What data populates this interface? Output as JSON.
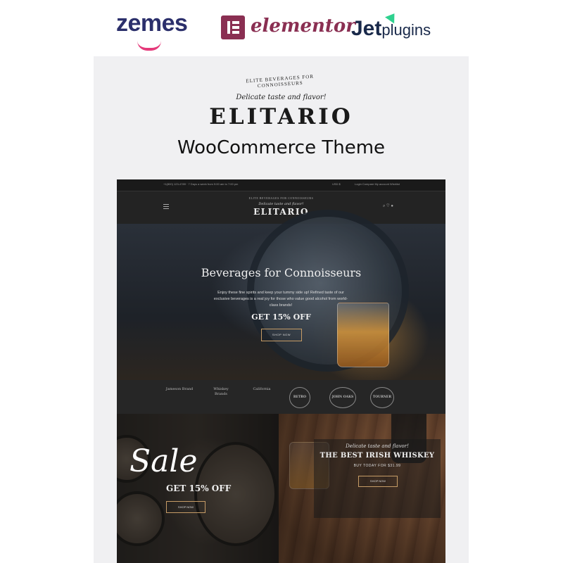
{
  "partners": {
    "zemes": "zemes",
    "elementor": "elementor",
    "jet_main": "Jet",
    "jet_sub": "plugins"
  },
  "branding": {
    "tagline": "ELITE BEVERAGES FOR CONNOISSEURS",
    "script": "Delicate taste and flavor!",
    "name": "ELITARIO",
    "subtitle": "WooCommerce Theme"
  },
  "preview": {
    "topbar": {
      "contact": "+1(800) 123-4789 · 7 Days a week from 9:00 am to 7:00 pm",
      "currency": "USD $",
      "links": "Login  Compare  My account  Wishlist"
    },
    "header": {
      "tagline": "ELITE BEVERAGES FOR CONNOISSEURS",
      "script": "Delicate taste and flavor!",
      "logo": "ELITARIO",
      "icons": "⌕  ♡ ●"
    },
    "hero": {
      "title": "Beverages for Connoisseurs",
      "text": "Enjoy these fine spirits and keep your tummy side up! Refined taste of our exclusive beverages is a real joy for those who value good alcohol from world-class brands!",
      "offer": "GET 15% OFF",
      "button": "SHOP NOW"
    },
    "brands": [
      "Jameson Brand",
      "Whiskey Brands",
      "California",
      "RETRO PRESS",
      "JOHN OAKS",
      "TOURNER"
    ],
    "promo_left": {
      "title": "Sale",
      "offer": "GET 15% OFF",
      "button": "SHOP NOW"
    },
    "promo_right": {
      "script": "Delicate taste and flavor!",
      "title": "THE BEST IRISH WHISKEY",
      "price": "BUY TODAY FOR $31.99",
      "button": "SHOP NOW"
    }
  },
  "colors": {
    "zemes_accent": "#e5397a",
    "elementor": "#8a2f52",
    "jet_accent": "#2fd18f",
    "button_border": "#c69c66"
  }
}
